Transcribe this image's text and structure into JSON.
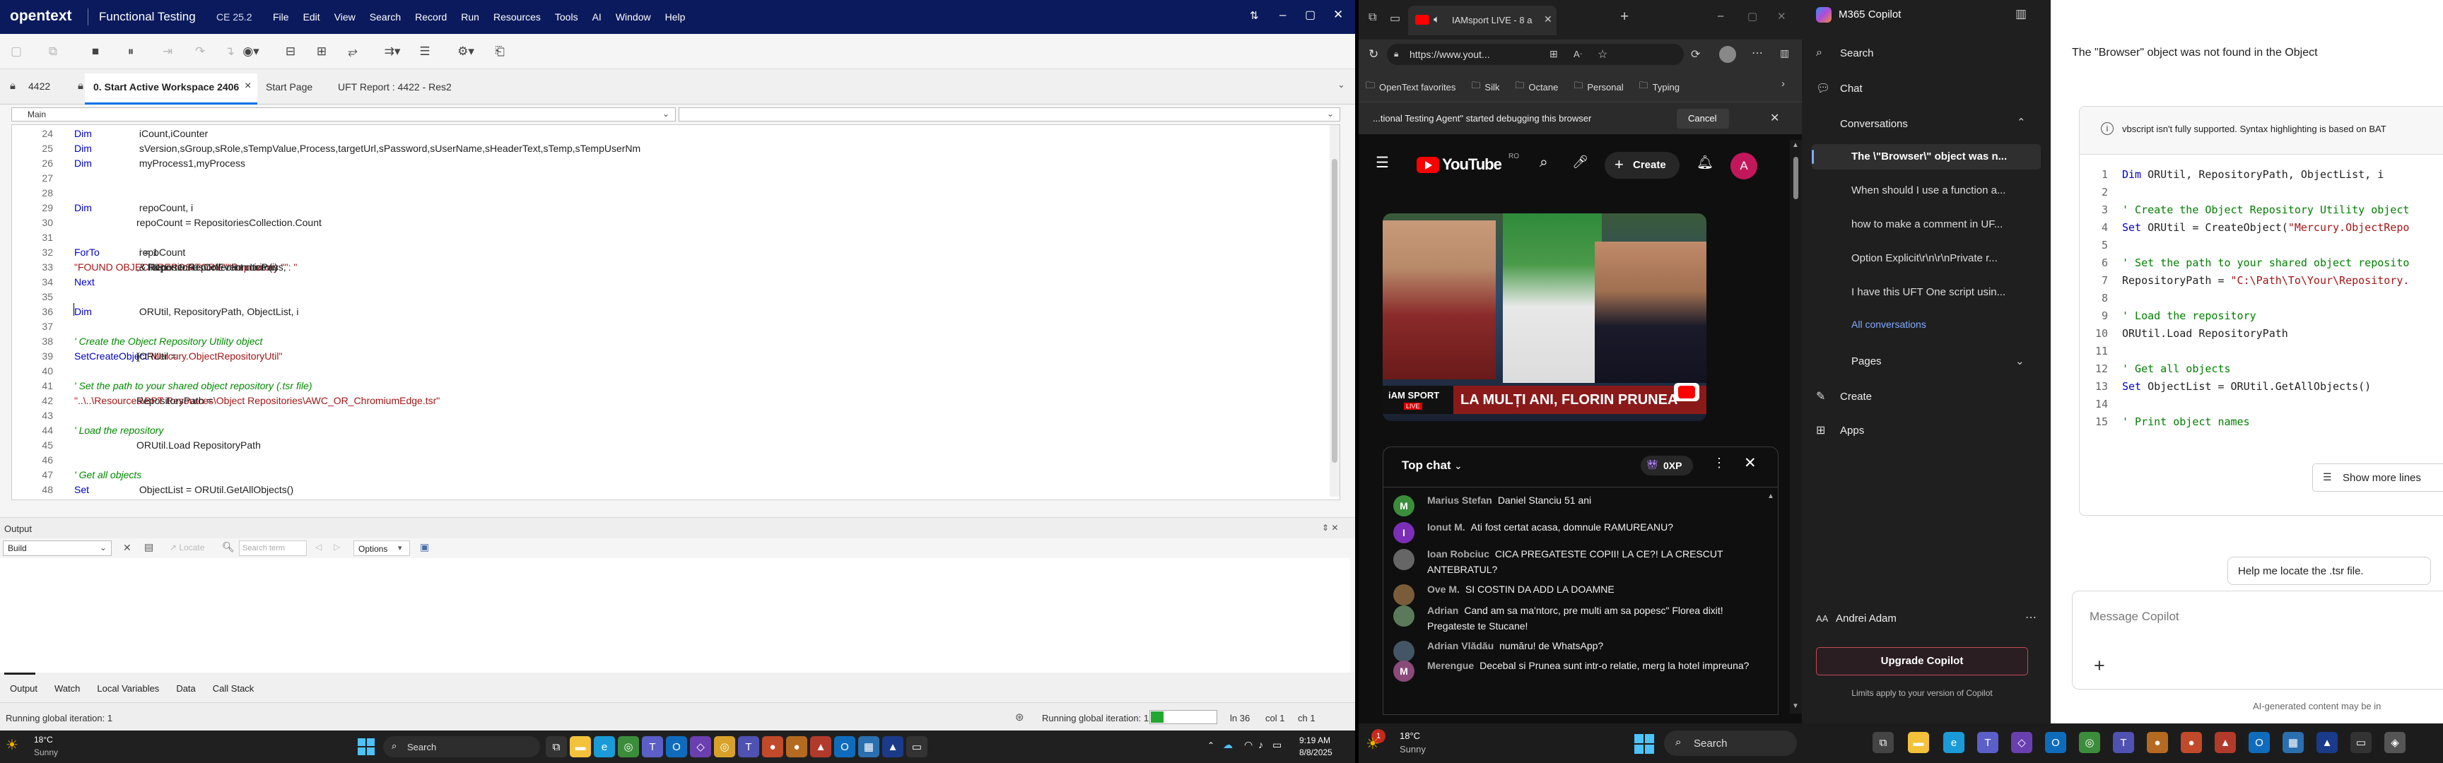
{
  "uft": {
    "brand": "opentext",
    "app_title": "Functional Testing",
    "version": "CE 25.2",
    "menu": [
      "File",
      "Edit",
      "View",
      "Search",
      "Record",
      "Run",
      "Resources",
      "Tools",
      "AI",
      "Window",
      "Help"
    ],
    "window_controls": {
      "minimize": "–",
      "restore": "▢",
      "close": "✕",
      "extra": "⇅"
    },
    "tabs_bar": {
      "solution_label": "4422",
      "tabs": [
        {
          "label": "0. Start Active Workspace 2406",
          "active": true,
          "close": "×"
        },
        {
          "label": "Start Page",
          "active": false
        },
        {
          "label": "UFT Report : 4422 - Res2",
          "active": false
        }
      ],
      "pin": "⌄"
    },
    "action_select": "Main",
    "code_lines": [
      {
        "n": "24",
        "parts": [
          {
            "k": "kw",
            "t": "Dim"
          },
          {
            "k": "tx",
            "t": " iCount,iCounter"
          }
        ]
      },
      {
        "n": "25",
        "parts": [
          {
            "k": "kw",
            "t": "Dim"
          },
          {
            "k": "tx",
            "t": " sVersion,sGroup,sRole,sTempValue,Process,targetUrl,sPassword,sUserName,sHeaderText,sTemp,sTempUserNm"
          }
        ]
      },
      {
        "n": "26",
        "parts": [
          {
            "k": "kw",
            "t": "Dim"
          },
          {
            "k": "tx",
            "t": " myProcess1,myProcess"
          }
        ]
      },
      {
        "n": "27",
        "parts": []
      },
      {
        "n": "28",
        "parts": []
      },
      {
        "n": "29",
        "parts": [
          {
            "k": "kw",
            "t": "Dim"
          },
          {
            "k": "tx",
            "t": " repoCount, i"
          }
        ]
      },
      {
        "n": "30",
        "parts": [
          {
            "k": "tx",
            "t": "repoCount = RepositoriesCollection.Count"
          }
        ]
      },
      {
        "n": "31",
        "parts": []
      },
      {
        "n": "32",
        "parts": [
          {
            "k": "kw",
            "t": "For"
          },
          {
            "k": "tx",
            "t": " i = 1 "
          },
          {
            "k": "kw",
            "t": "To"
          },
          {
            "k": "tx",
            "t": " repoCount"
          }
        ]
      },
      {
        "n": "33",
        "parts": [
          {
            "k": "tx",
            "t": "    Reporter.ReportEvent micPass, "
          },
          {
            "k": "str",
            "t": "\"FOUND OBJECT REPOSITORY:\""
          },
          {
            "k": "tx",
            "t": ", "
          },
          {
            "k": "str",
            "t": "\"Repository \""
          },
          {
            "k": "tx",
            "t": " & i & "
          },
          {
            "k": "str",
            "t": "\": \""
          },
          {
            "k": "tx",
            "t": " & RepositoriesCollection.Item(i)"
          }
        ]
      },
      {
        "n": "34",
        "parts": [
          {
            "k": "kw",
            "t": "Next"
          }
        ]
      },
      {
        "n": "35",
        "parts": []
      },
      {
        "n": "36",
        "parts": [
          {
            "k": "kw",
            "t": "Dim"
          },
          {
            "k": "tx",
            "t": " ORUtil, RepositoryPath, ObjectList, i"
          }
        ]
      },
      {
        "n": "37",
        "parts": []
      },
      {
        "n": "38",
        "parts": [
          {
            "k": "cm",
            "t": "' Create the Object Repository Utility object"
          }
        ]
      },
      {
        "n": "39",
        "parts": [
          {
            "k": "kw",
            "t": "Set"
          },
          {
            "k": "tx",
            "t": " ORUtil = "
          },
          {
            "k": "kw",
            "t": "CreateObject"
          },
          {
            "k": "tx",
            "t": "("
          },
          {
            "k": "str",
            "t": "\"Mercury.ObjectRepositoryUtil\""
          },
          {
            "k": "tx",
            "t": ")"
          }
        ]
      },
      {
        "n": "40",
        "parts": []
      },
      {
        "n": "41",
        "parts": [
          {
            "k": "cm",
            "t": "' Set the path to your shared object repository (.tsr file)"
          }
        ]
      },
      {
        "n": "42",
        "parts": [
          {
            "k": "tx",
            "t": "RepositoryPath = "
          },
          {
            "k": "str",
            "t": "\"..\\..\\Resources\\BPT Resources\\Object Repositories\\AWC_OR_ChromiumEdge.tsr\""
          }
        ]
      },
      {
        "n": "43",
        "parts": []
      },
      {
        "n": "44",
        "parts": [
          {
            "k": "cm",
            "t": "' Load the repository"
          }
        ]
      },
      {
        "n": "45",
        "parts": [
          {
            "k": "tx",
            "t": "ORUtil.Load RepositoryPath"
          }
        ]
      },
      {
        "n": "46",
        "parts": []
      },
      {
        "n": "47",
        "parts": [
          {
            "k": "cm",
            "t": "' Get all objects"
          }
        ]
      },
      {
        "n": "48",
        "parts": [
          {
            "k": "kw",
            "t": "Set"
          },
          {
            "k": "tx",
            "t": " ObjectList = ORUtil.GetAllObjects()"
          }
        ]
      }
    ],
    "output": {
      "title": "Output",
      "pane_ctrl": "⇕ ✕",
      "build_select": "Build",
      "locate": "Locate",
      "search_placeholder": "Search term",
      "options": "Options",
      "bottom_tabs": [
        "Output",
        "Watch",
        "Local Variables",
        "Data",
        "Call Stack"
      ]
    },
    "status": {
      "left": "Running global iteration: 1",
      "right": "Running global iteration: 1",
      "ln": "ln 36",
      "col": "col 1",
      "ch": "ch 1",
      "progress": 0.2
    }
  },
  "edge": {
    "tab_title": "IAMsport LIVE - 8 a",
    "address": "https://www.yout...",
    "favorites": [
      "OpenText favorites",
      "Silk",
      "Octane",
      "Personal",
      "Typing"
    ],
    "debug_banner": "...tional Testing Agent\" started debugging this browser",
    "cancel": "Cancel",
    "youtube": {
      "logo": "YouTube",
      "region": "RO",
      "create": "Create",
      "avatar": "A"
    },
    "video": {
      "brand": "iAM SPORT",
      "live": "LIVE",
      "caption": "LA MULȚI ANI, FLORIN PRUNEA"
    },
    "top_chat": "Top chat",
    "xp": "0XP",
    "chat": [
      {
        "initial": "M",
        "color": "#3b8d3b",
        "author": "Marius Stefan",
        "text": "Daniel Stanciu 51 ani"
      },
      {
        "initial": "I",
        "color": "#7b2fb8",
        "author": "Ionut M.",
        "text": "Ati fost certat acasa, domnule RAMUREANU?"
      },
      {
        "initial": "",
        "color": "#666",
        "author": "Ioan Robciuc",
        "text": "CICA PREGATESTE COPII! LA CE?! LA CRESCUT ANTEBRATUL?"
      },
      {
        "initial": "",
        "color": "#7a5c3a",
        "author": "Ove M.",
        "text": "SI COSTIN DA ADD LA DOAMNE"
      },
      {
        "initial": "",
        "color": "#5a7a5a",
        "author": "Adrian",
        "text": "Cand am sa ma'ntorc, pre multi am sa popesc\" Florea dixit! Pregateste te Stucane!"
      },
      {
        "initial": "",
        "color": "#445566",
        "author": "Adrian Vlădău",
        "text": "număru! de WhatsApp?"
      },
      {
        "initial": "M",
        "color": "#8a4a7a",
        "author": "Merengue",
        "text": "Decebal si Prunea sunt intr-o relatie, merg la hotel impreuna?"
      }
    ]
  },
  "copilot": {
    "app_title": "M365 Copilot",
    "nav": {
      "search": "Search",
      "chat": "Chat",
      "conversations": "Conversations",
      "pages": "Pages",
      "create": "Create",
      "apps": "Apps"
    },
    "conversations": [
      "The \\\"Browser\\\" object was n...",
      "When should I use a function a...",
      "how to make a comment in UF...",
      "Option Explicit\\r\\n\\r\\nPrivate r...",
      "I have this UFT One script usin..."
    ],
    "all_conversations": "All conversations",
    "user": {
      "initials": "AA",
      "name": "Andrei Adam"
    },
    "upgrade": "Upgrade Copilot",
    "limits": "Limits apply to your version of Copilot",
    "response_text": "The \"Browser\" object was not found in the Object",
    "warning": "vbscript isn't fully supported. Syntax highlighting is based on BAT",
    "code": [
      {
        "n": "1",
        "parts": [
          {
            "k": "kw",
            "t": "Dim"
          },
          {
            "k": "tx",
            "t": " ORUtil, RepositoryPath, ObjectList, i"
          }
        ]
      },
      {
        "n": "2",
        "parts": []
      },
      {
        "n": "3",
        "parts": [
          {
            "k": "cm",
            "t": "' Create the Object Repository Utility object"
          }
        ]
      },
      {
        "n": "4",
        "parts": [
          {
            "k": "kw",
            "t": "Set"
          },
          {
            "k": "tx",
            "t": " ORUtil = CreateObject("
          },
          {
            "k": "str",
            "t": "\"Mercury.ObjectRepo"
          }
        ]
      },
      {
        "n": "5",
        "parts": []
      },
      {
        "n": "6",
        "parts": [
          {
            "k": "cm",
            "t": "' Set the path to your shared object reposito"
          }
        ]
      },
      {
        "n": "7",
        "parts": [
          {
            "k": "tx",
            "t": "RepositoryPath = "
          },
          {
            "k": "str",
            "t": "\"C:\\Path\\To\\Your\\Repository."
          }
        ]
      },
      {
        "n": "8",
        "parts": []
      },
      {
        "n": "9",
        "parts": [
          {
            "k": "cm",
            "t": "' Load the repository"
          }
        ]
      },
      {
        "n": "10",
        "parts": [
          {
            "k": "tx",
            "t": "ORUtil.Load RepositoryPath"
          }
        ]
      },
      {
        "n": "11",
        "parts": []
      },
      {
        "n": "12",
        "parts": [
          {
            "k": "cm",
            "t": "' Get all objects"
          }
        ]
      },
      {
        "n": "13",
        "parts": [
          {
            "k": "kw",
            "t": "Set"
          },
          {
            "k": "tx",
            "t": " ObjectList = ORUtil.GetAllObjects()"
          }
        ]
      },
      {
        "n": "14",
        "parts": []
      },
      {
        "n": "15",
        "parts": [
          {
            "k": "cm",
            "t": "' Print object names"
          }
        ]
      }
    ],
    "show_more": "Show more lines",
    "suggestion": "Help me locate the .tsr file.",
    "message_placeholder": "Message Copilot",
    "disclaimer": "AI-generated content may be in"
  },
  "taskbar_left": {
    "weather_temp": "18°C",
    "weather_desc": "Sunny",
    "search": "Search",
    "time": "9:19 AM",
    "date": "8/8/2025"
  },
  "taskbar_right": {
    "weather_temp": "18°C",
    "weather_desc": "Sunny",
    "search": "Search",
    "badge": "1"
  }
}
